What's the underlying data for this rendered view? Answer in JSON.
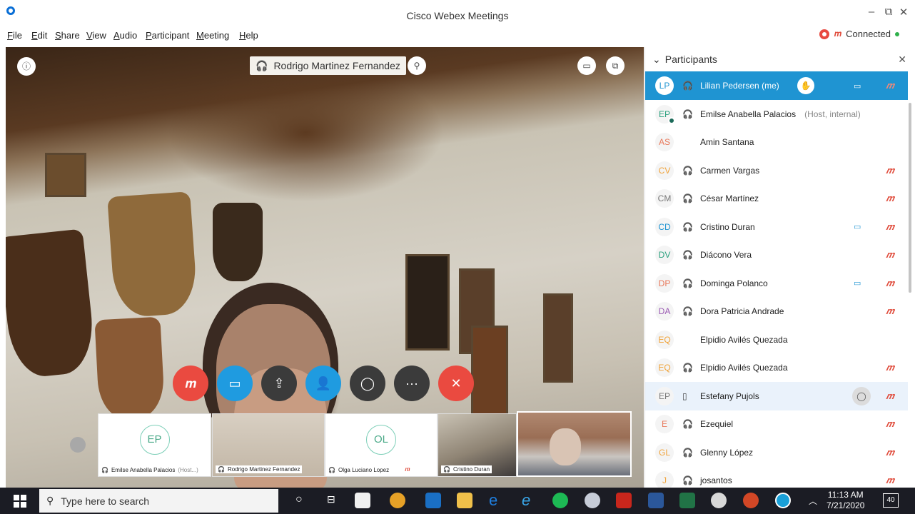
{
  "window": {
    "title": "Cisco Webex Meetings",
    "min": "–",
    "restore": "⧉",
    "close": "✕"
  },
  "menu": [
    "File",
    "Edit",
    "Share",
    "View",
    "Audio",
    "Participant",
    "Meeting",
    "Help"
  ],
  "status": {
    "connection": "Connected"
  },
  "video": {
    "active_speaker": "Rodrigo Martinez Fernandez"
  },
  "controls": {
    "mute": "mute",
    "video": "video",
    "share": "share",
    "participants": "participants",
    "chat": "chat",
    "more": "···",
    "leave": "✕"
  },
  "thumbnails": [
    {
      "initials": "EP",
      "name": "Emilse Anabella Palacios",
      "tag": "(Host...)"
    },
    {
      "initials": "",
      "name": "Rodrigo Martinez Fernandez",
      "tag": ""
    },
    {
      "initials": "OL",
      "name": "Olga Luciano Lopez",
      "tag": ""
    },
    {
      "initials": "",
      "name": "Cristino Duran",
      "tag": ""
    }
  ],
  "participants_panel": {
    "title": "Participants",
    "rows": [
      {
        "initials": "LP",
        "name": "Lilian Pedersen",
        "suffix": "(me)",
        "color": "#1f94d2"
      },
      {
        "initials": "EP",
        "name": "Emilse Anabella Palacios",
        "suffix": "(Host, internal)",
        "color": "#2aa07d"
      },
      {
        "initials": "AS",
        "name": "Amin Santana",
        "suffix": "",
        "color": "#e8785a"
      },
      {
        "initials": "CV",
        "name": "Carmen Vargas",
        "suffix": "",
        "color": "#f0a33a"
      },
      {
        "initials": "CM",
        "name": "César Martínez",
        "suffix": "",
        "color": "#777"
      },
      {
        "initials": "CD",
        "name": "Cristino Duran",
        "suffix": "",
        "color": "#1f94d2"
      },
      {
        "initials": "DV",
        "name": "Diácono Vera",
        "suffix": "",
        "color": "#2aa07d"
      },
      {
        "initials": "DP",
        "name": "Dominga Polanco",
        "suffix": "",
        "color": "#e8785a"
      },
      {
        "initials": "DA",
        "name": "Dora Patricia Andrade",
        "suffix": "",
        "color": "#9a5ab3"
      },
      {
        "initials": "EQ",
        "name": "Elpidio Avilés Quezada",
        "suffix": "",
        "color": "#f0a33a"
      },
      {
        "initials": "EQ",
        "name": "Elpidio Avilés Quezada",
        "suffix": "",
        "color": "#f0a33a"
      },
      {
        "initials": "EP",
        "name": "Estefany Pujols",
        "suffix": "",
        "color": "#777"
      },
      {
        "initials": "E",
        "name": "Ezequiel",
        "suffix": "",
        "color": "#e8785a"
      },
      {
        "initials": "GL",
        "name": "Glenny López",
        "suffix": "",
        "color": "#f0a33a"
      },
      {
        "initials": "J",
        "name": "josantos",
        "suffix": "",
        "color": "#f0a33a"
      }
    ]
  },
  "taskbar": {
    "search_placeholder": "Type here to search",
    "time": "11:13 AM",
    "date": "7/21/2020",
    "notification_count": "40"
  }
}
